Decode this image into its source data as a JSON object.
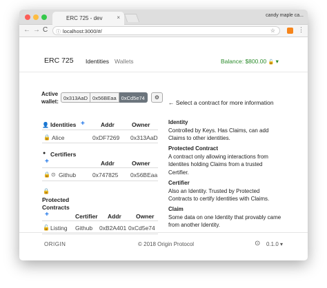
{
  "browser": {
    "tab_title": "ERC 725 - dev",
    "tab_close": "×",
    "profile_name": "candy maple ca...",
    "url": "localhost:3000/#/",
    "back_icon": "←",
    "forward_icon": "→",
    "reload_icon": "C",
    "info_icon": "ⓘ",
    "star_icon": "☆",
    "menu_icon": "⋮"
  },
  "header": {
    "brand": "ERC 725",
    "nav": [
      "Identities",
      "Wallets"
    ],
    "balance": "Balance: $800.00",
    "balance_icon": "🔓",
    "balance_caret": "▾"
  },
  "wallet": {
    "label": "Active wallet:",
    "buttons": [
      "0x313AaD",
      "0x56BEaa",
      "0xCd5e74"
    ],
    "active_index": 2,
    "settings_icon": "⚙"
  },
  "identities": {
    "header": "Identities",
    "add_icon": "+",
    "person_icon": "👤",
    "cols": [
      "Addr",
      "Owner"
    ],
    "rows": [
      {
        "icon": "🔒",
        "name": "Alice",
        "addr": "0xDF7269",
        "owner": "0x313AaD"
      }
    ]
  },
  "certifiers": {
    "header": "Certifiers",
    "add_icon": "+",
    "circle_icon": "●",
    "cols": [
      "Addr",
      "Owner"
    ],
    "rows": [
      {
        "icon": "🔒",
        "sub_icon": "⊙",
        "name": "Github",
        "addr": "0x747825",
        "owner": "0x56BEaa"
      }
    ]
  },
  "contracts": {
    "header": "Protected Contracts",
    "lock_icon": "🔒",
    "add_icon": "+",
    "cols": [
      "Certifier",
      "Addr",
      "Owner"
    ],
    "rows": [
      {
        "icon": "🔓",
        "name": "Listing",
        "certifier": "Github",
        "addr": "0xB2A401",
        "owner": "0xCd5e74"
      }
    ]
  },
  "detail": {
    "arrow_icon": "←",
    "prompt": "Select a contract for more information",
    "definitions": [
      {
        "term": "Identity",
        "text": "Controlled by Keys. Has Claims, can add Claims to other identities."
      },
      {
        "term": "Protected Contract",
        "text": "A contract only allowing interactions from Identites holding Claims from a trusted Certifier."
      },
      {
        "term": "Certifier",
        "text": "Also an Identity. Trusted by Protected Contracts to certify Identities with Claims."
      },
      {
        "term": "Claim",
        "text": "Some data on one Identity that provably came from another Identity."
      }
    ]
  },
  "footer": {
    "logo": "ORIGIN",
    "copyright": "© 2018  Origin Protocol",
    "github_icon": "⊙",
    "version": "0.1.0 ▾"
  },
  "colors": {
    "accent_blue": "#1a73e8",
    "balance_green": "#2a8a2a",
    "active_wallet": "#6c757d"
  }
}
